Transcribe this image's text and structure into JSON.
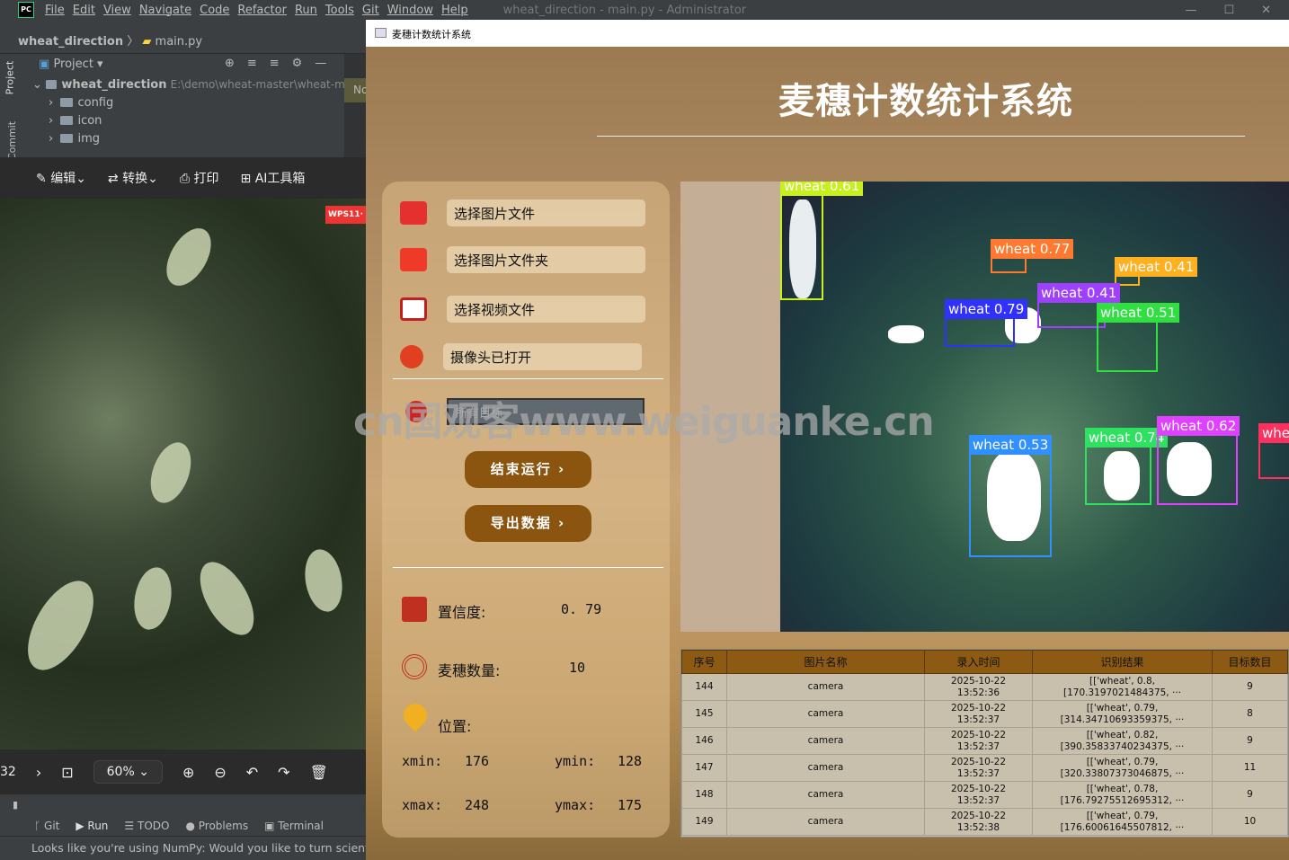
{
  "ide": {
    "menu": [
      "File",
      "Edit",
      "View",
      "Navigate",
      "Code",
      "Refactor",
      "Run",
      "Tools",
      "Git",
      "Window",
      "Help"
    ],
    "window_title": "wheat_direction - main.py - Administrator",
    "breadcrumb": {
      "project": "wheat_direction",
      "file": "main.py"
    },
    "side_tabs": {
      "project": "Project",
      "commit": "Commit"
    },
    "project_header": "Project",
    "tree": {
      "root": "wheat_direction",
      "root_path": "E:\\demo\\wheat-master\\wheat-maste",
      "children": [
        "config",
        "icon",
        "img"
      ]
    },
    "editor_tab_partial": "No",
    "tool_tabs": [
      "Git",
      "Run",
      "TODO",
      "Problems",
      "Terminal"
    ],
    "status_message": "Looks like you're using NumPy: Would you like to turn scientific"
  },
  "viewer": {
    "toolbar": [
      "编辑",
      "转换",
      "打印",
      "AI工具箱"
    ],
    "badge": "WPS11·",
    "page_partial": "32",
    "zoom": "60%"
  },
  "app": {
    "window_title": "麦穗计数统计系统",
    "title": "麦穗计数统计系统",
    "buttons": {
      "select_image": "选择图片文件",
      "select_folder": "选择图片文件夹",
      "select_video": "选择视频文件",
      "camera": "摄像头已打开",
      "stop": "结束运行",
      "export": "导出数据"
    },
    "combo_value": "所有目标",
    "info": {
      "confidence_label": "置信度:",
      "confidence": "0. 79",
      "count_label": "麦穗数量:",
      "count": "10",
      "position_label": "位置:",
      "xmin_label": "xmin:",
      "xmin": "176",
      "ymin_label": "ymin:",
      "ymin": "128",
      "xmax_label": "xmax:",
      "xmax": "248",
      "ymax_label": "ymax:",
      "ymax": "175"
    },
    "detections": [
      {
        "label": "wheat 0.61",
        "color": "#c8f020"
      },
      {
        "label": "wheat 0.77",
        "color": "#ff7a30"
      },
      {
        "label": "wheat 0.41",
        "color": "#ffb020"
      },
      {
        "label": "wheat 0.41",
        "color": "#a040ff"
      },
      {
        "label": "wheat 0.79",
        "color": "#3030ff"
      },
      {
        "label": "wheat 0.51",
        "color": "#30e040"
      },
      {
        "label": "wheat 0.53",
        "color": "#3090ff"
      },
      {
        "label": "wheat 0.74",
        "color": "#30e060"
      },
      {
        "label": "wheat 0.62",
        "color": "#e040ff"
      },
      {
        "label": "whe",
        "color": "#ff3060"
      }
    ],
    "table": {
      "headers": [
        "序号",
        "图片名称",
        "录入时间",
        "识别结果",
        "目标数目"
      ],
      "rows": [
        {
          "id": "144",
          "name": "camera",
          "date": "2025-10-22",
          "time": "13:52:36",
          "r1": "[['wheat', 0.8,",
          "r2": "[170.3197021484375,",
          "more": "···",
          "count": "9"
        },
        {
          "id": "145",
          "name": "camera",
          "date": "2025-10-22",
          "time": "13:52:37",
          "r1": "[['wheat', 0.79,",
          "r2": "[314.34710693359375,",
          "more": "···",
          "count": "8"
        },
        {
          "id": "146",
          "name": "camera",
          "date": "2025-10-22",
          "time": "13:52:37",
          "r1": "[['wheat', 0.82,",
          "r2": "[390.35833740234375,",
          "more": "···",
          "count": "9"
        },
        {
          "id": "147",
          "name": "camera",
          "date": "2025-10-22",
          "time": "13:52:37",
          "r1": "[['wheat', 0.79,",
          "r2": "[320.33807373046875,",
          "more": "···",
          "count": "11"
        },
        {
          "id": "148",
          "name": "camera",
          "date": "2025-10-22",
          "time": "13:52:37",
          "r1": "[['wheat', 0.78,",
          "r2": "[176.79275512695312,",
          "more": "···",
          "count": "9"
        },
        {
          "id": "149",
          "name": "camera",
          "date": "2025-10-22",
          "time": "13:52:38",
          "r1": "[['wheat', 0.79,",
          "r2": "[176.60061645507812,",
          "more": "···",
          "count": "10"
        }
      ]
    }
  },
  "watermark": "cn国观客www.weiguanke.cn"
}
